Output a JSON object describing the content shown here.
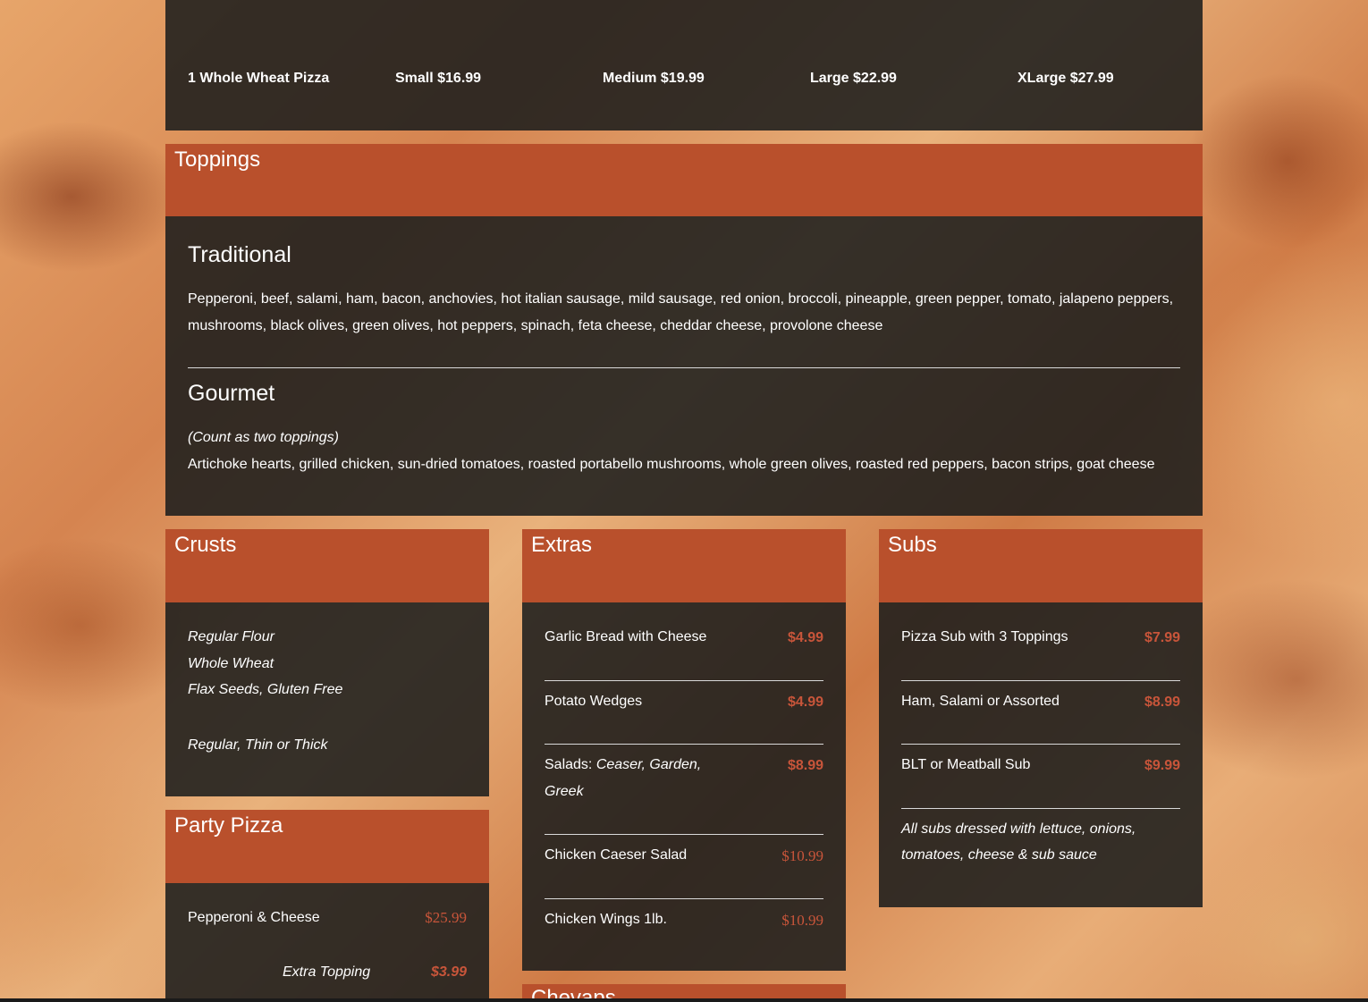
{
  "pizza_sizes": {
    "item": "1 Whole Wheat Pizza",
    "small": "Small $16.99",
    "medium": "Medium $19.99",
    "large": "Large $22.99",
    "xlarge": "XLarge $27.99"
  },
  "toppings": {
    "title": "Toppings",
    "traditional_title": "Traditional",
    "traditional_line1": "Pepperoni, beef, salami, ham, bacon, anchovies, hot italian sausage, mild sausage, red onion, broccoli, pineapple, green pepper, tomato, jalapeno peppers,",
    "traditional_line2": "mushrooms, black olives, green olives, hot peppers, spinach, feta cheese, cheddar cheese, provolone cheese",
    "gourmet_title": "Gourmet",
    "gourmet_note": "(Count as two toppings)",
    "gourmet_list": "Artichoke hearts, grilled chicken, sun-dried tomatoes, roasted portabello mushrooms, whole green olives, roasted red peppers, bacon strips, goat cheese"
  },
  "crusts": {
    "title": "Crusts",
    "items": [
      "Regular Flour",
      "Whole Wheat",
      "Flax Seeds, Gluten Free"
    ],
    "thickness": "Regular, Thin or Thick"
  },
  "party_pizza": {
    "title": "Party Pizza",
    "item": "Pepperoni & Cheese",
    "price": "$25.99",
    "extra_label": "Extra Topping",
    "extra_price": "$3.99"
  },
  "extras": {
    "title": "Extras",
    "items": [
      {
        "name": "Garlic Bread with Cheese",
        "price": "$4.99"
      },
      {
        "name": "Potato Wedges",
        "price": "$4.99"
      },
      {
        "name": "Salads: ",
        "sub_a": "Ceaser, Garden,",
        "sub_b": "Greek",
        "price": "$8.99"
      },
      {
        "name": "Chicken Caeser Salad",
        "price": "$10.99"
      },
      {
        "name": "Chicken Wings 1lb.",
        "price": "$10.99"
      }
    ]
  },
  "subs": {
    "title": "Subs",
    "items": [
      {
        "name": "Pizza Sub with 3 Toppings",
        "price": "$7.99"
      },
      {
        "name": "Ham, Salami or Assorted",
        "price": "$8.99"
      },
      {
        "name": "BLT or Meatball Sub",
        "price": "$9.99"
      }
    ],
    "note_line1": "All subs dressed with lettuce, onions,",
    "note_line2": "tomatoes, cheese & sub sauce"
  },
  "next_section": {
    "title": "Chevaps"
  },
  "colors": {
    "header": "#b9502c",
    "panel": "#1c1e1c",
    "price": "#c8553a"
  }
}
